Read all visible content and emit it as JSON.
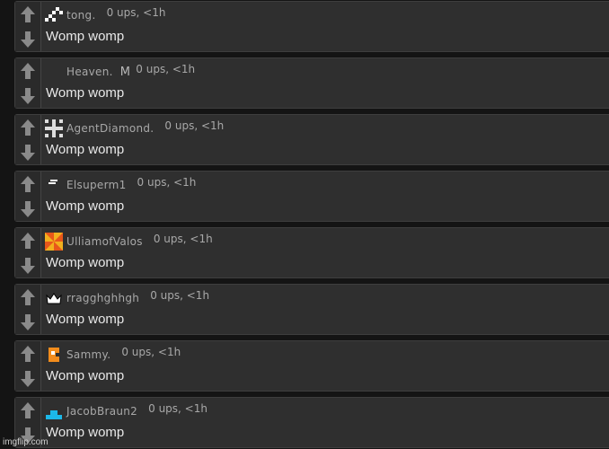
{
  "comments": [
    {
      "username": "tong.",
      "flair": "",
      "meta": "0 ups, <1h",
      "text": "Womp womp",
      "avatar": "pixel-avatar-icon"
    },
    {
      "username": "Heaven.",
      "flair": "M",
      "meta": "0 ups, <1h",
      "text": "Womp womp",
      "avatar": ""
    },
    {
      "username": "AgentDiamond.",
      "flair": "",
      "meta": "0 ups, <1h",
      "text": "Womp womp",
      "avatar": "pixel-avatar-icon"
    },
    {
      "username": "Elsuperm1",
      "flair": "",
      "meta": "0 ups, <1h",
      "text": "Womp womp",
      "avatar": "dash-avatar-icon"
    },
    {
      "username": "UlliamofValos",
      "flair": "",
      "meta": "0 ups, <1h",
      "text": "Womp womp",
      "avatar": "pinwheel-avatar-icon"
    },
    {
      "username": "rragghghhgh",
      "flair": "",
      "meta": "0 ups, <1h",
      "text": "Womp womp",
      "avatar": "crown-avatar-icon"
    },
    {
      "username": "Sammy.",
      "flair": "",
      "meta": "0 ups, <1h",
      "text": "Womp womp",
      "avatar": "orange-block-avatar-icon"
    },
    {
      "username": "JacobBraun2",
      "flair": "",
      "meta": "0 ups, <1h",
      "text": "Womp womp",
      "avatar": "blue-hat-avatar-icon"
    }
  ],
  "watermark": "imgflip.com",
  "colors": {
    "background": "#141414",
    "panel": "#2f2f2f",
    "text": "#e8e8e8",
    "meta": "#a8a8a8"
  }
}
